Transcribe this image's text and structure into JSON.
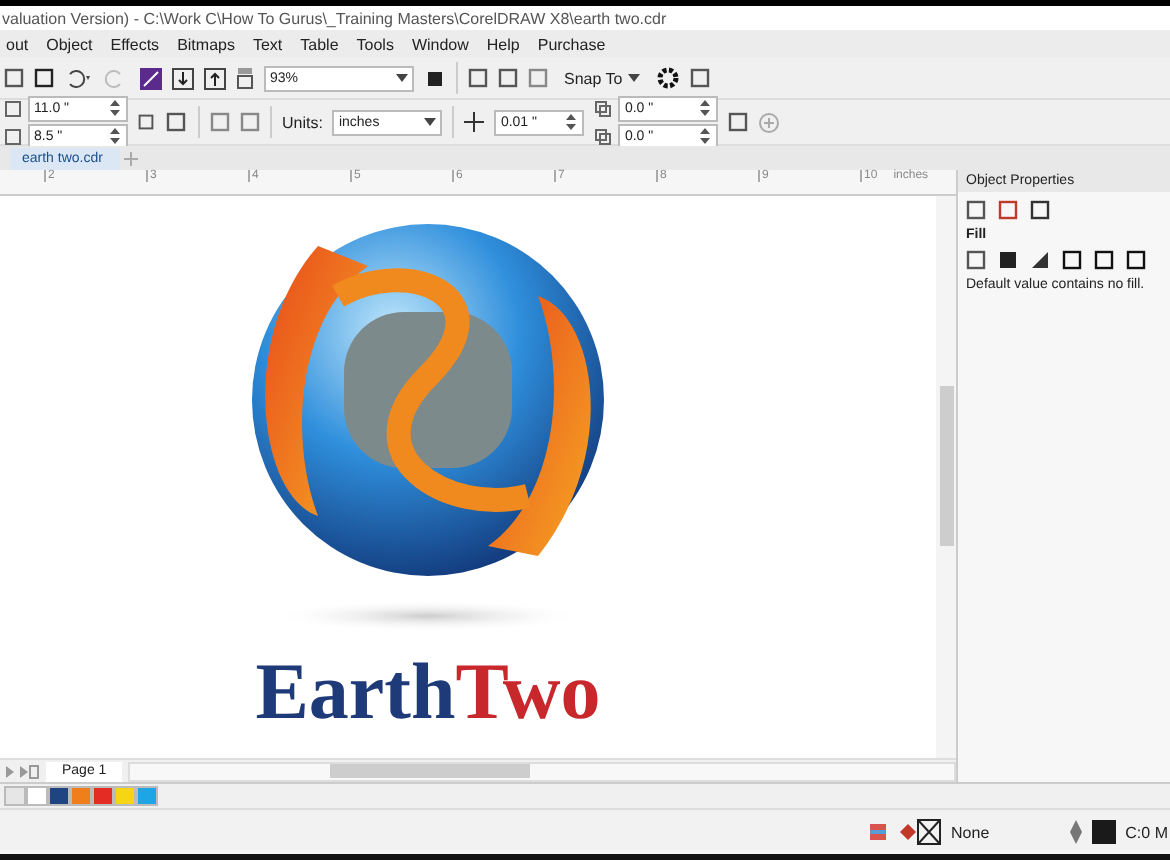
{
  "window": {
    "title": "valuation Version) - C:\\Work C\\How To Gurus\\_Training Masters\\CorelDRAW X8\\earth two.cdr"
  },
  "menu": [
    "out",
    "Object",
    "Effects",
    "Bitmaps",
    "Text",
    "Table",
    "Tools",
    "Window",
    "Help",
    "Purchase"
  ],
  "toolbar": {
    "zoom": "93%",
    "snap": "Snap To"
  },
  "property_bar": {
    "width": "11.0 \"",
    "height": "8.5 \"",
    "units_label": "Units:",
    "units": "inches",
    "nudge": "0.01 \"",
    "dup_x": "0.0 \"",
    "dup_y": "0.0 \""
  },
  "document_tabs": [
    {
      "label": "earth two.cdr",
      "selected": true
    }
  ],
  "ruler": {
    "ticks": [
      "2",
      "3",
      "4",
      "5",
      "6",
      "7",
      "8",
      "9",
      "10"
    ],
    "unit": "inches"
  },
  "logo": {
    "words": [
      {
        "text": "Earth",
        "color": "#1e3a78"
      },
      {
        "text": "Two",
        "color": "#c8282c"
      }
    ]
  },
  "page_tabs": [
    {
      "label": "Page 1",
      "selected": true
    }
  ],
  "palette": [
    {
      "color": "#e6e6e6"
    },
    {
      "color": "#ffffff"
    },
    {
      "color": "#1e4582"
    },
    {
      "color": "#ef7f1a"
    },
    {
      "color": "#e52c24"
    },
    {
      "color": "#f5d514"
    },
    {
      "color": "#1ea5e6"
    }
  ],
  "docker": {
    "title": "Object Properties",
    "section": "Fill",
    "message": "Default value contains no fill."
  },
  "status_bar": {
    "fill": "None",
    "outline": "C:0 M"
  }
}
